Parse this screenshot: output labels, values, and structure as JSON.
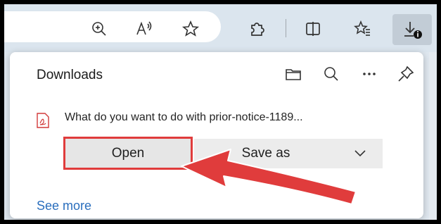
{
  "toolbar": {
    "icons": [
      "zoom-icon",
      "read-aloud-icon",
      "favorite-star-icon",
      "extensions-icon",
      "split-screen-icon",
      "favorites-icon",
      "downloads-icon"
    ],
    "downloads_active": true
  },
  "downloads_panel": {
    "title": "Downloads",
    "header_icons": [
      "folder-icon",
      "search-icon",
      "more-options-icon",
      "pin-icon"
    ],
    "item": {
      "file_icon": "pdf-file-icon",
      "prompt": "What do you want to do with prior-notice-1189...",
      "actions": {
        "open": "Open",
        "save_as": "Save as"
      }
    },
    "see_more": "See more"
  },
  "annotation": {
    "highlight_color": "#e03c3c",
    "target": "Open"
  },
  "colors": {
    "accent_link": "#2a6ebd",
    "highlight": "#e03c3c"
  }
}
